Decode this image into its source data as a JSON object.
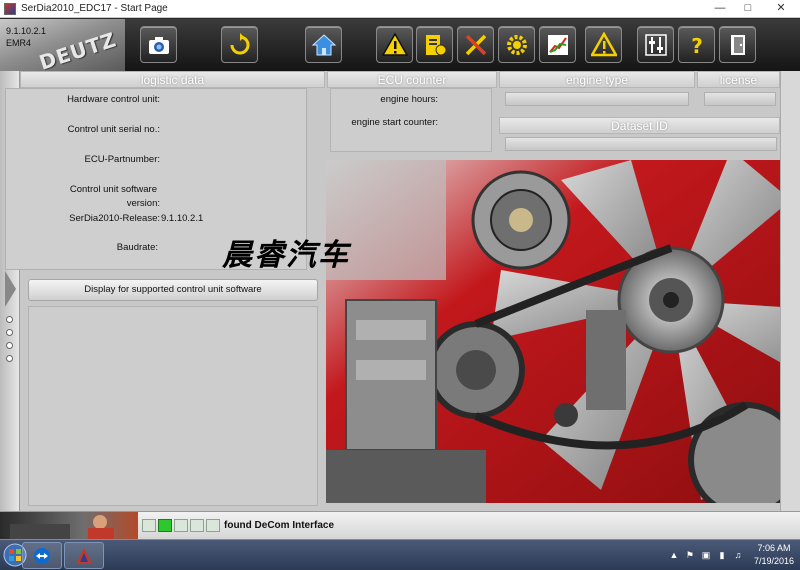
{
  "window": {
    "title": "SerDia2010_EDC17 - Start Page"
  },
  "brand": {
    "version": "9.1.10.2.1",
    "module": "EMR4",
    "logo_text": "DEUTZ"
  },
  "toolbar": {
    "buttons": [
      {
        "name": "camera-button",
        "icon": "camera-icon"
      },
      {
        "name": "refresh-button",
        "icon": "refresh-icon"
      },
      {
        "name": "home-button",
        "icon": "home-icon"
      },
      {
        "name": "warning-button",
        "icon": "warning-icon"
      },
      {
        "name": "parameters-button",
        "icon": "parameters-icon"
      },
      {
        "name": "tools-button",
        "icon": "tools-icon"
      },
      {
        "name": "settings-button",
        "icon": "gear-icon"
      },
      {
        "name": "graph-button",
        "icon": "graph-icon"
      },
      {
        "name": "alert-button",
        "icon": "alert-icon"
      },
      {
        "name": "adjust-button",
        "icon": "sliders-icon"
      },
      {
        "name": "help-button",
        "icon": "help-icon"
      },
      {
        "name": "exit-button",
        "icon": "exit-icon"
      }
    ]
  },
  "headers": {
    "logistic": "logistic data",
    "ecu_counter": "ECU counter",
    "engine_type": "engine type",
    "license": "license",
    "dataset_id": "Dataset ID"
  },
  "logistic_fields": {
    "hardware": "Hardware control unit:",
    "serial": "Control unit serial no.:",
    "ecu_part": "ECU-Partnumber:",
    "software_1": "Control unit software",
    "software_2": "version:",
    "release": "SerDia2010-Release:",
    "release_value": "9.1.10.2.1",
    "baudrate": "Baudrate:"
  },
  "ecu_fields": {
    "hours": "engine hours:",
    "starts": "engine start counter:"
  },
  "display_button": "Display for supported control unit software",
  "watermark": "晨睿汽车",
  "status": {
    "text": "found DeCom Interface",
    "leds": [
      false,
      true,
      false,
      false,
      false
    ]
  },
  "clock": {
    "time": "7:06 AM",
    "date": "7/19/2016"
  },
  "colors": {
    "toolbar_bg": "#1e1e1e",
    "accent_yellow": "#f5d000",
    "engine_red": "#b01818",
    "led_on": "#2ec72e"
  }
}
